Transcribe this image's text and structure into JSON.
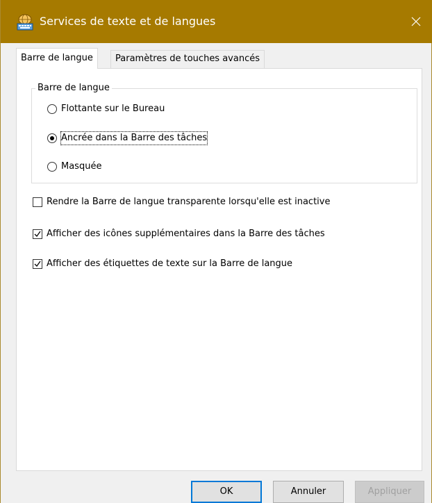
{
  "window": {
    "title": "Services de texte et de langues",
    "title_color": "#a67a00"
  },
  "tabs": [
    {
      "label": "Barre de langue",
      "active": true
    },
    {
      "label": "Paramètres de touches avancés",
      "active": false
    }
  ],
  "group": {
    "legend": "Barre de langue",
    "options": [
      {
        "label": "Flottante sur le Bureau",
        "checked": false
      },
      {
        "label": "Ancrée dans la Barre des tâches",
        "checked": true
      },
      {
        "label": "Masquée",
        "checked": false
      }
    ]
  },
  "checkboxes": [
    {
      "label": "Rendre la Barre de langue transparente lorsqu'elle est inactive",
      "checked": false
    },
    {
      "label": "Afficher des icônes supplémentaires dans la Barre des tâches",
      "checked": true
    },
    {
      "label": "Afficher des étiquettes de texte sur la Barre de langue",
      "checked": true
    }
  ],
  "buttons": {
    "ok": "OK",
    "cancel": "Annuler",
    "apply": "Appliquer"
  },
  "icons": {
    "title": "keyboard-globe-icon",
    "close": "close-icon"
  }
}
